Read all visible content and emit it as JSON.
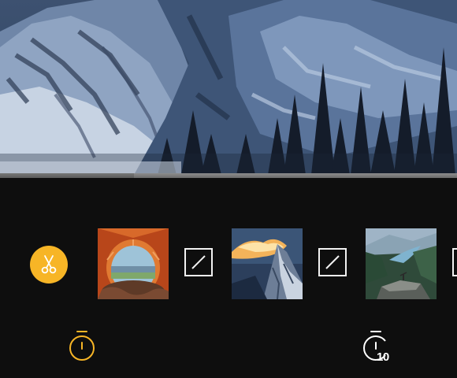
{
  "preview": {
    "description_icon": "mountain-video-frame"
  },
  "editor": {
    "cut_button": {
      "icon": "scissors-icon",
      "color": "#f7b526"
    },
    "clips": [
      {
        "name": "tent-view",
        "icon": "clip-thumbnail"
      },
      {
        "name": "mountain-peak",
        "icon": "clip-thumbnail"
      },
      {
        "name": "valley-rock",
        "icon": "clip-thumbnail"
      }
    ],
    "transitions": [
      {
        "icon": "transition-slash-icon"
      },
      {
        "icon": "transition-slash-icon"
      }
    ],
    "timers": {
      "left": {
        "icon": "stopwatch-icon",
        "color": "#f7b526"
      },
      "right": {
        "icon": "stopwatch-10-icon",
        "label": "10",
        "color": "#ffffff"
      }
    }
  }
}
